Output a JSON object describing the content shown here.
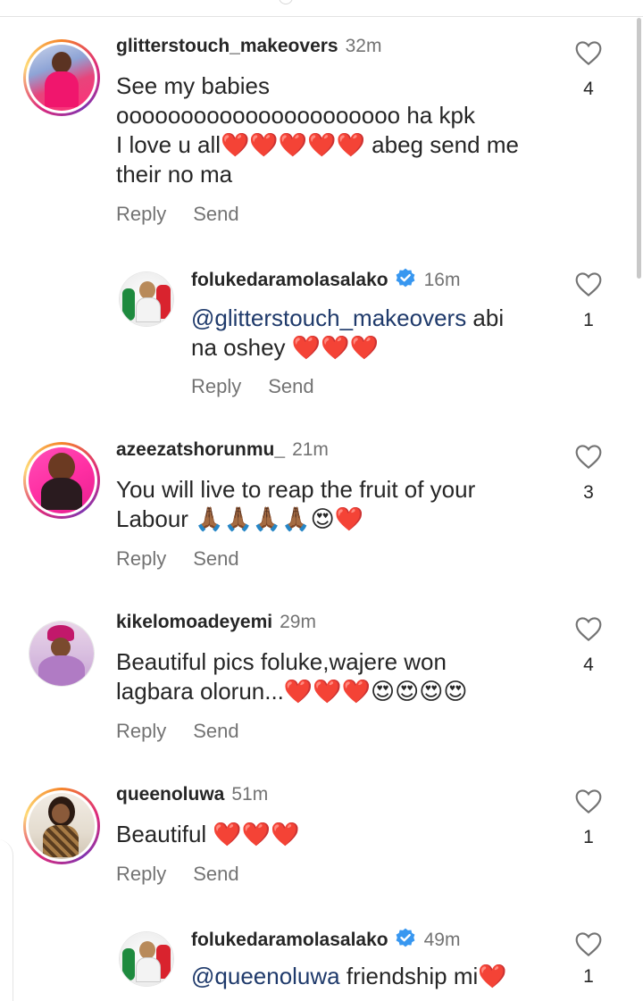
{
  "comments": [
    {
      "username": "glitterstouch_makeovers",
      "time": "32m",
      "lines": [
        "See my babies",
        "oooooooooooooooooooooo ha kpk",
        "I love u all❤️❤️❤️❤️❤️ abeg send me",
        "their no ma"
      ],
      "reply": "Reply",
      "send": "Send",
      "likes": "4"
    },
    {
      "username": "folukedaramolasalako",
      "verified": true,
      "time": "16m",
      "mention": "@glitterstouch_makeovers",
      "lines": [
        " abi",
        "na oshey ❤️❤️❤️"
      ],
      "reply": "Reply",
      "send": "Send",
      "likes": "1"
    },
    {
      "username": "azeezatshorunmu_",
      "time": "21m",
      "lines": [
        "You will live to reap the fruit of your",
        "Labour 🙏🏾🙏🏾🙏🏾🙏🏾😍❤️"
      ],
      "reply": "Reply",
      "send": "Send",
      "likes": "3"
    },
    {
      "username": "kikelomoadeyemi",
      "time": "29m",
      "lines": [
        "Beautiful pics foluke,wajere won",
        "lagbara olorun...❤️❤️❤️😍😍😍😍"
      ],
      "reply": "Reply",
      "send": "Send",
      "likes": "4"
    },
    {
      "username": "queenoluwa",
      "time": "51m",
      "lines": [
        "Beautiful ❤️❤️❤️"
      ],
      "reply": "Reply",
      "send": "Send",
      "likes": "1"
    },
    {
      "username": "folukedaramolasalako",
      "verified": true,
      "time": "49m",
      "mention": "@queenoluwa",
      "lines": [
        " friendship mi❤️"
      ],
      "likes": "1"
    }
  ],
  "colors": {
    "verified_blue": "#3897f0",
    "heart_red": "#e0112b",
    "mention_blue": "#1f3a6b",
    "muted_text": "#737373"
  }
}
